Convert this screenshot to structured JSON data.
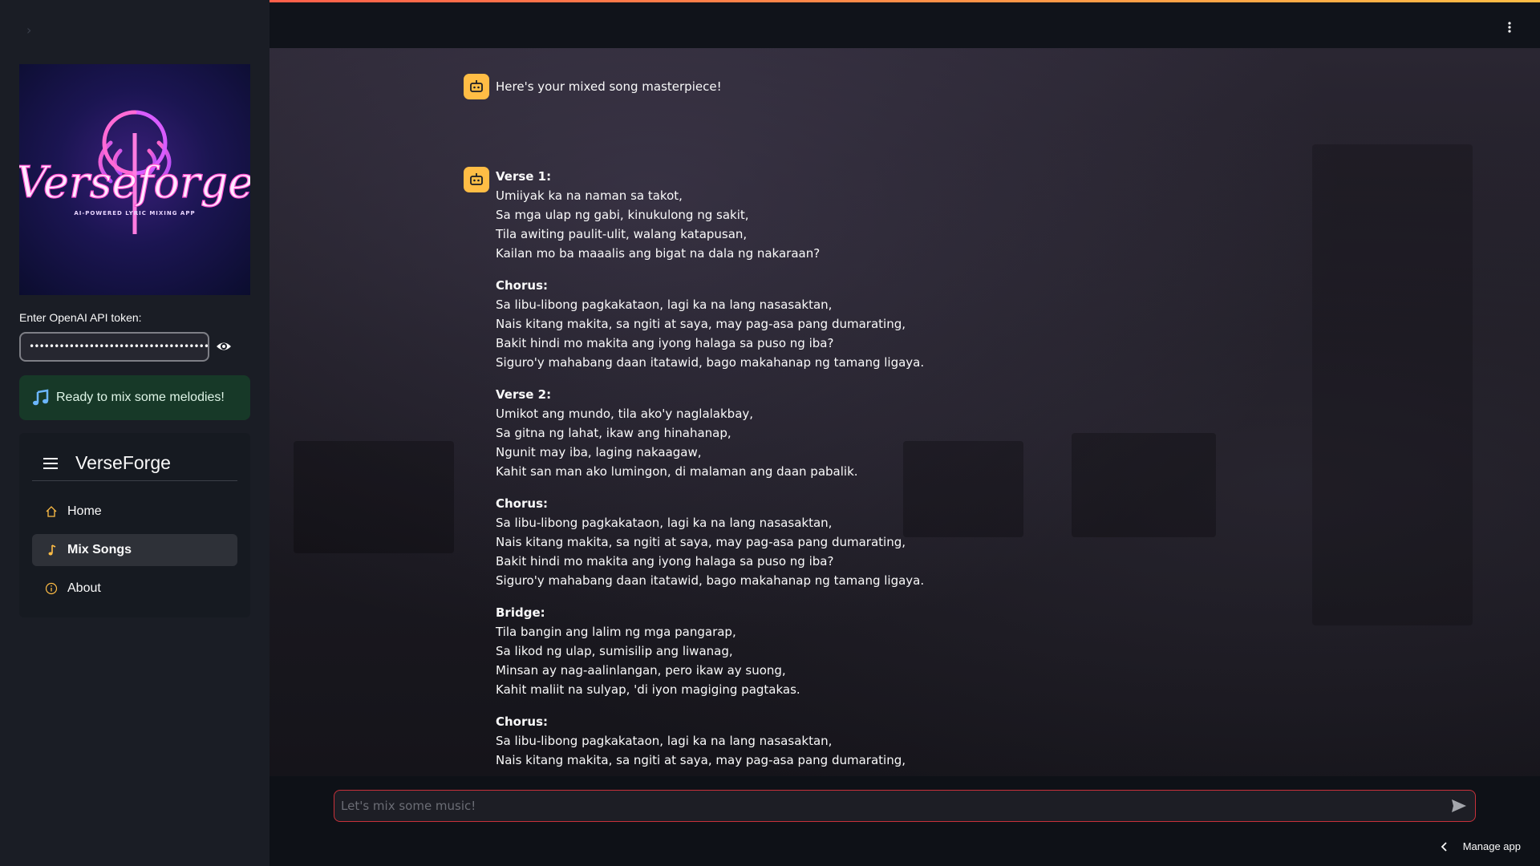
{
  "sidebar": {
    "logo": {
      "wordmark": "Verseforge",
      "tagline": "AI-POWERED LYRIC MIXING APP"
    },
    "token_label": "Enter OpenAI API token:",
    "token_value": "••••••••••••••••••••••••••••••••••••••••••••••••••",
    "status_text": "Ready to mix some melodies!",
    "menu": {
      "title": "VerseForge",
      "items": [
        {
          "label": "Home",
          "icon": "home-icon",
          "active": false
        },
        {
          "label": "Mix Songs",
          "icon": "music-note-icon",
          "active": true
        },
        {
          "label": "About",
          "icon": "info-icon",
          "active": false
        }
      ]
    }
  },
  "chat": {
    "intro_message": "Here's your mixed song masterpiece!",
    "song": [
      {
        "heading": "Verse 1:",
        "lines": [
          "Umiiyak ka na naman sa takot,",
          "Sa mga ulap ng gabi, kinukulong ng sakit,",
          "Tila awiting paulit-ulit, walang katapusan,",
          "Kailan mo ba maaalis ang bigat na dala ng nakaraan?"
        ]
      },
      {
        "heading": "Chorus:",
        "lines": [
          "Sa libu-libong pagkakataon, lagi ka na lang nasasaktan,",
          "Nais kitang makita, sa ngiti at saya, may pag-asa pang dumarating,",
          "Bakit hindi mo makita ang iyong halaga sa puso ng iba?",
          "Siguro'y mahabang daan itatawid, bago makahanap ng tamang ligaya."
        ]
      },
      {
        "heading": "Verse 2:",
        "lines": [
          "Umikot ang mundo, tila ako'y naglalakbay,",
          "Sa gitna ng lahat, ikaw ang hinahanap,",
          "Ngunit may iba, laging nakaagaw,",
          "Kahit san man ako lumingon, di malaman ang daan pabalik."
        ]
      },
      {
        "heading": "Chorus:",
        "lines": [
          "Sa libu-libong pagkakataon, lagi ka na lang nasasaktan,",
          "Nais kitang makita, sa ngiti at saya, may pag-asa pang dumarating,",
          "Bakit hindi mo makita ang iyong halaga sa puso ng iba?",
          "Siguro'y mahabang daan itatawid, bago makahanap ng tamang ligaya."
        ]
      },
      {
        "heading": "Bridge:",
        "lines": [
          "Tila bangin ang lalim ng mga pangarap,",
          "Sa likod ng ulap, sumisilip ang liwanag,",
          "Minsan ay nag-aalinlangan, pero ikaw ay suong,",
          "Kahit maliit na sulyap, 'di iyon magiging pagtakas."
        ]
      },
      {
        "heading": "Chorus:",
        "lines": [
          "Sa libu-libong pagkakataon, lagi ka na lang nasasaktan,",
          "Nais kitang makita, sa ngiti at saya, may pag-asa pang dumarating,"
        ]
      }
    ],
    "input_placeholder": "Let's mix some music!"
  },
  "footer": {
    "manage_app": "Manage app"
  },
  "colors": {
    "accent": "#ff4b4b",
    "avatar": "#ffbd45",
    "status_bg": "#173928"
  }
}
